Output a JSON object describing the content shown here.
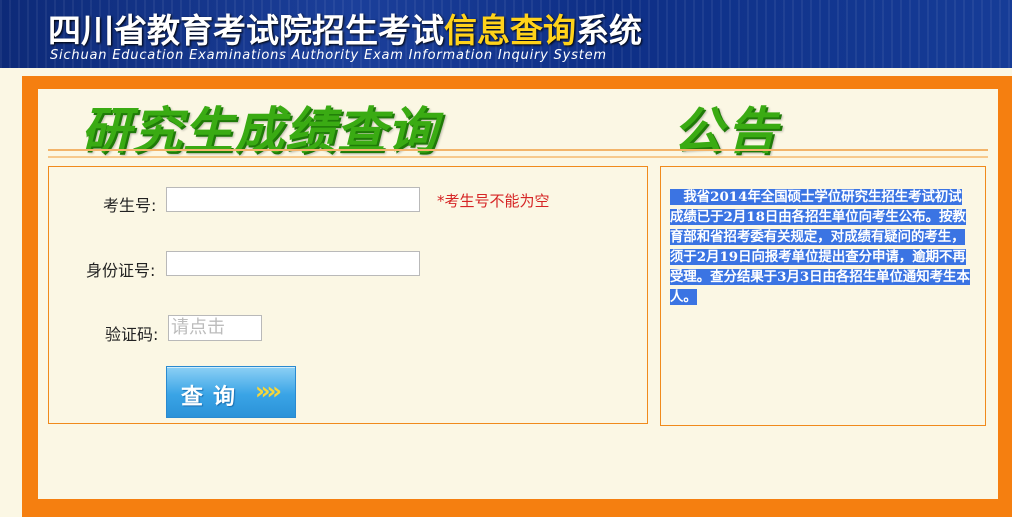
{
  "header": {
    "title_part1": "四川省教育考试院招生考试",
    "title_part2": "信息查询",
    "title_part3": "系统",
    "subtitle": "Sichuan Education Examinations Authority Exam Information Inquiry System"
  },
  "main": {
    "heading": "研究生成绩查询",
    "notice_heading": "公告"
  },
  "form": {
    "exam_no_label": "考生号:",
    "exam_no_value": "",
    "exam_no_error": "*考生号不能为空",
    "id_label": "身份证号:",
    "id_value": "",
    "captcha_label": "验证码:",
    "captcha_placeholder": "请点击",
    "submit_label": "查询",
    "submit_arrows": "»»"
  },
  "notice": {
    "text": "　我省2014年全国硕士学位研究生招生考试初试成绩已于2月18日由各招生单位向考生公布。按教育部和省招考委有关规定，对成绩有疑问的考生，须于2月19日向报考单位提出查分申请，逾期不再受理。查分结果于3月3日由各招生单位通知考生本人。"
  },
  "colors": {
    "header_bg": "#1b3f9a",
    "title_highlight": "#ffd21a",
    "frame": "#f57f10",
    "heading_green": "#3aab13",
    "error_red": "#d62525",
    "selection_blue": "#3b74e3"
  }
}
